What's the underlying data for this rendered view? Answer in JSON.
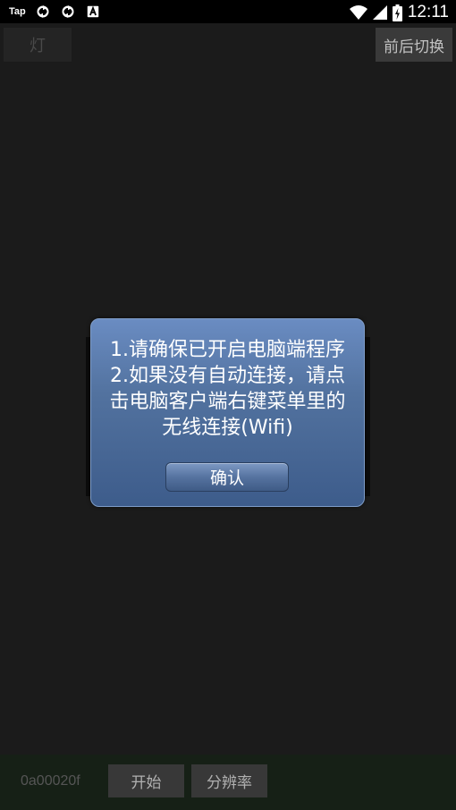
{
  "status_bar": {
    "tap_label": "Tap",
    "icons": [
      "sync-icon",
      "sync-icon",
      "font-a-icon",
      "wifi-icon",
      "signal-icon",
      "battery-icon"
    ],
    "clock": "12:11"
  },
  "top": {
    "light_label": "灯",
    "switch_label": "前后切换"
  },
  "dialog": {
    "message": "1.请确保已开启电脑端程序\n2.如果没有自动连接，请点击电脑客户端右键菜单里的无线连接(Wifi)",
    "confirm_label": "确认"
  },
  "bottom": {
    "code": "0a00020f",
    "start_label": "开始",
    "resolution_label": "分辨率"
  },
  "colors": {
    "dialog_top": "#6a8cc2",
    "dialog_bottom": "#3d5c8b",
    "background": "#1b1b1b"
  }
}
